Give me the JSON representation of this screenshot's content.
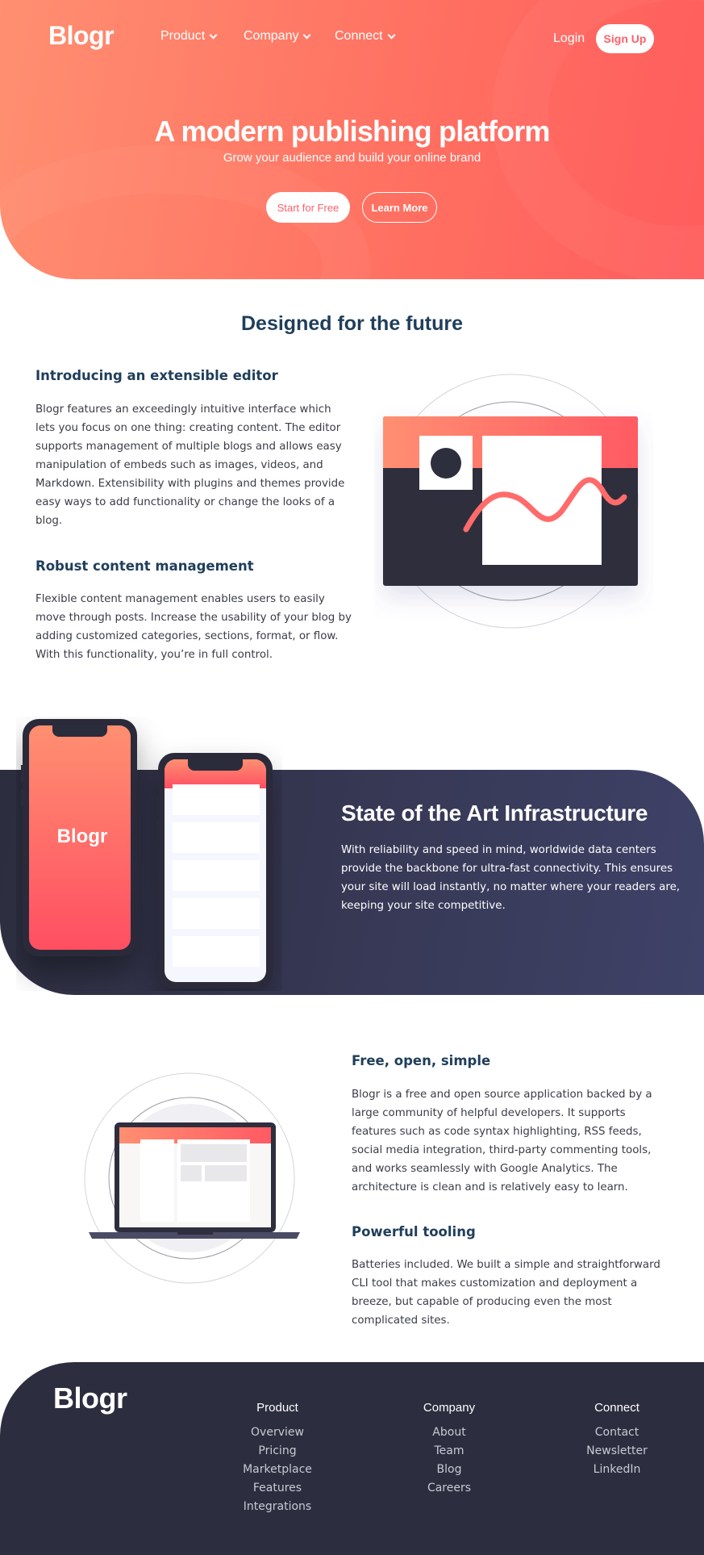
{
  "nav": {
    "logo": "Blogr",
    "items": [
      {
        "label": "Product"
      },
      {
        "label": "Company"
      },
      {
        "label": "Connect"
      }
    ],
    "login": "Login",
    "signup": "Sign Up"
  },
  "hero": {
    "title": "A modern publishing platform",
    "subtitle": "Grow your audience and build your online brand",
    "primary_button": "Start for Free",
    "secondary_button": "Learn More"
  },
  "designed": {
    "title": "Designed for the future",
    "features": [
      {
        "heading": "Introducing an extensible editor",
        "lines": [
          "Blogr features an exceedingly intuitive interface which",
          "lets you focus on one thing: creating content. The editor",
          "supports management of multiple blogs and allows easy",
          "manipulation of embeds such as images, videos, and",
          "Markdown. Extensibility with plugins and themes provide",
          "easy ways to add functionality or change the looks of a",
          "blog."
        ]
      },
      {
        "heading": "Robust content management",
        "lines": [
          "Flexible content management enables users to easily",
          "move through posts. Increase the usability of your blog by",
          "adding customized categories, sections, format, or flow.",
          "With this functionality, you’re in full control."
        ]
      }
    ]
  },
  "infrastructure": {
    "title": "State of the Art Infrastructure",
    "lines": [
      "With reliability and speed in mind, worldwide data centers",
      "provide the backbone for ultra-fast connectivity. This ensures",
      "your site will load instantly, no matter where your readers are,",
      "keeping your site competitive."
    ],
    "phone_logo": "Blogr"
  },
  "features2": [
    {
      "heading": "Free, open, simple",
      "lines": [
        "Blogr is a free and open source application backed by a",
        "large community of helpful developers. It supports",
        "features such as code syntax highlighting, RSS feeds,",
        "social media integration, third-party commenting tools,",
        "and works seamlessly with Google Analytics. The",
        "architecture is clean and is relatively easy to learn."
      ]
    },
    {
      "heading": "Powerful tooling",
      "lines": [
        "Batteries included. We built a simple and straightforward",
        "CLI tool that makes customization and deployment a",
        "breeze, but capable of producing even the most",
        "complicated sites."
      ]
    }
  ],
  "footer": {
    "logo": "Blogr",
    "columns": [
      {
        "heading": "Product",
        "links": [
          "Overview",
          "Pricing",
          "Marketplace",
          "Features",
          "Integrations"
        ]
      },
      {
        "heading": "Company",
        "links": [
          "About",
          "Team",
          "Blog",
          "Careers"
        ]
      },
      {
        "heading": "Connect",
        "links": [
          "Contact",
          "Newsletter",
          "LinkedIn"
        ]
      }
    ]
  },
  "colors": {
    "accent_coral": "#ff6f61",
    "navy_heading": "#1f3e5a",
    "dark_bg": "#2c2d3e"
  }
}
